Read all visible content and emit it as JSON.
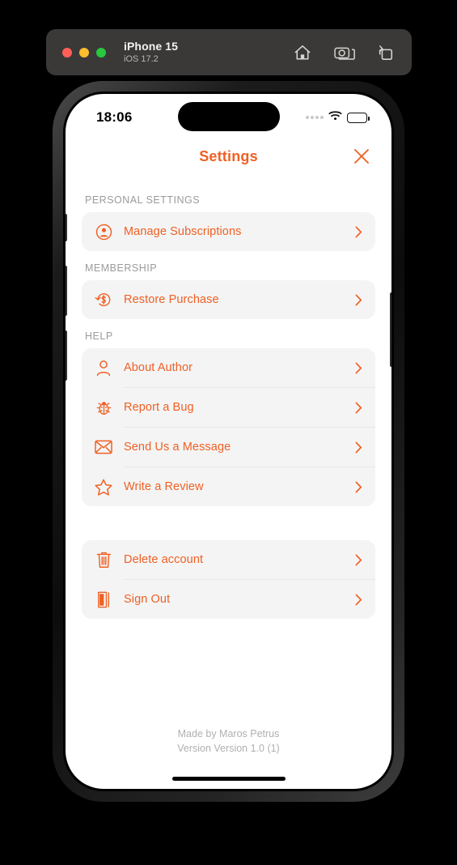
{
  "simulator": {
    "device_name": "iPhone 15",
    "os_version": "iOS 17.2",
    "traffic_lights": [
      "close",
      "minimize",
      "maximize"
    ],
    "toolbar_icons": [
      "home-icon",
      "screenshot-icon",
      "rotate-icon"
    ]
  },
  "status_bar": {
    "time": "18:06",
    "cellular": "cellular-dots-icon",
    "wifi": "wifi-icon",
    "battery": "battery-icon"
  },
  "nav": {
    "title": "Settings",
    "close_icon": "close-icon"
  },
  "sections": [
    {
      "header": "PERSONAL SETTINGS",
      "rows": [
        {
          "label": "Manage Subscriptions",
          "icon": "person-circle-icon"
        }
      ]
    },
    {
      "header": "MEMBERSHIP",
      "rows": [
        {
          "label": "Restore Purchase",
          "icon": "restore-dollar-icon"
        }
      ]
    },
    {
      "header": "HELP",
      "rows": [
        {
          "label": "About Author",
          "icon": "person-icon"
        },
        {
          "label": "Report a Bug",
          "icon": "ladybug-icon"
        },
        {
          "label": "Send Us a Message",
          "icon": "envelope-icon"
        },
        {
          "label": "Write a Review",
          "icon": "star-icon"
        }
      ]
    },
    {
      "header": "",
      "rows": [
        {
          "label": "Delete account",
          "icon": "trash-icon"
        },
        {
          "label": "Sign Out",
          "icon": "sign-out-door-icon"
        }
      ]
    }
  ],
  "footer": {
    "made_by": "Made by Maros Petrus",
    "version": "Version Version 1.0 (1)"
  },
  "colors": {
    "accent": "#ef6024",
    "section_header": "#9b9b9b",
    "card_bg": "#f4f4f4",
    "footer_text": "#b0b0b0",
    "simulator_bar": "#3a3937"
  }
}
